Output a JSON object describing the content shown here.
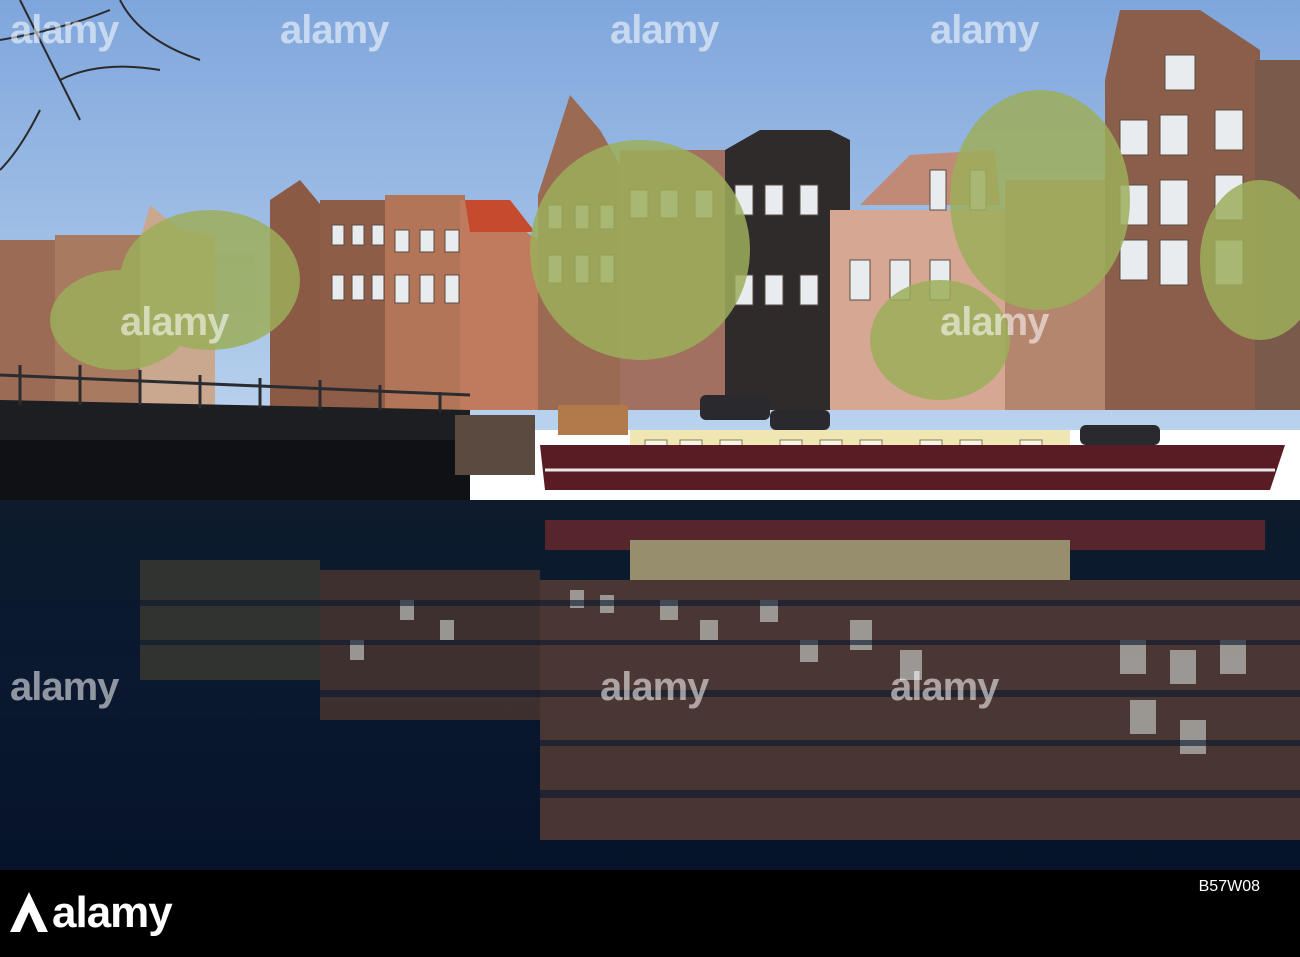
{
  "watermark": {
    "text": "alamy"
  },
  "footer": {
    "brand": "alamy",
    "image_code": "B57W08"
  },
  "colors": {
    "sky": "#8fb7e6",
    "water": "#07162a",
    "brick": "#8d5a45",
    "boat_hull": "#5a1c24",
    "cabin": "#efe6b4",
    "footer": "#000000"
  }
}
